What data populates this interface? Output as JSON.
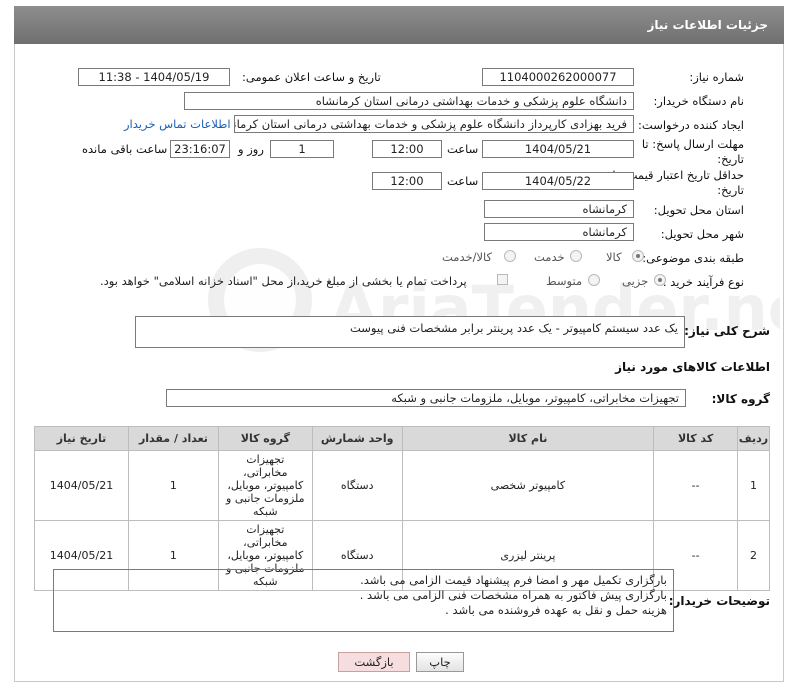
{
  "header": {
    "title": "جزئیات اطلاعات نیاز"
  },
  "fields": {
    "need_number_label": "شماره نیاز:",
    "need_number": "1104000262000077",
    "announce_label": "تاریخ و ساعت اعلان عمومی:",
    "announce_value": "1404/05/19 - 11:38",
    "buyer_org_label": "نام دستگاه خریدار:",
    "buyer_org": "دانشگاه علوم پزشکی و خدمات بهداشتی  درمانی استان کرمانشاه",
    "requester_label": "ایجاد کننده درخواست:",
    "requester": "فرید  بهزادی کارپرداز دانشگاه علوم پزشکی و خدمات بهداشتی  درمانی استان کرمانشاه",
    "contact_link": "اطلاعات تماس خریدار",
    "deadline_label": "مهلت ارسال پاسخ: تا تاریخ:",
    "deadline_date": "1404/05/21",
    "time_label": "ساعت",
    "deadline_time": "12:00",
    "days_value": "1",
    "days_label": "روز و",
    "remaining_time": "23:16:07",
    "remaining_label": "ساعت باقی مانده",
    "validity_label": "حداقل تاریخ اعتبار قیمت: تا تاریخ:",
    "validity_date": "1404/05/22",
    "validity_time": "12:00",
    "province_label": "استان محل تحویل:",
    "province": "کرمانشاه",
    "city_label": "شهر محل تحویل:",
    "city": "کرمانشاه",
    "category_label": "طبقه بندی موضوعی:",
    "category_options": [
      "کالا",
      "خدمت",
      "کالا/خدمت"
    ],
    "process_label": "نوع فرآیند خرید :",
    "process_options": [
      "جزیی",
      "متوسط"
    ],
    "payment_note": "پرداخت تمام یا بخشی از مبلغ خرید،از محل \"اسناد خزانه اسلامی\" خواهد بود.",
    "summary_label": "شرح کلی نیاز:",
    "summary": "یک عدد سیستم کامپیوتر - یک عدد پرینتر برابر مشخصات فنی پیوست",
    "goods_info_title": "اطلاعات کالاهای مورد نیاز",
    "goods_group_label": "گروه کالا:",
    "goods_group": "تجهیزات مخابراتی، کامپیوتر، موبایل، ملزومات جانبی و شبکه"
  },
  "table": {
    "headers": [
      "ردیف",
      "کد کالا",
      "نام کالا",
      "واحد شمارش",
      "گروه کالا",
      "تعداد / مقدار",
      "تاریخ نیاز"
    ],
    "rows": [
      {
        "row": "1",
        "code": "--",
        "name": "کامپیوتر شخصی",
        "unit": "دستگاه",
        "group": "تجهیزات مخابراتی، کامپیوتر، موبایل، ملزومات جانبی و شبکه",
        "qty": "1",
        "date": "1404/05/21"
      },
      {
        "row": "2",
        "code": "--",
        "name": "پرینتر لیزری",
        "unit": "دستگاه",
        "group": "تجهیزات مخابراتی، کامپیوتر، موبایل، ملزومات جانبی و شبکه",
        "qty": "1",
        "date": "1404/05/21"
      }
    ]
  },
  "buyer_notes": {
    "label": "توضیحات خریدار:",
    "lines": [
      "بارگزاری تکمیل مهر و امضا فرم پیشنهاد قیمت الزامی می باشد.",
      "بارگزاری پیش فاکتور به همراه مشخصات فنی الزامی می باشد .",
      "هزینه حمل و نقل به عهده فروشنده می باشد ."
    ]
  },
  "buttons": {
    "print": "چاپ",
    "back": "بازگشت"
  },
  "watermark": {
    "text": "AriaTender.net"
  },
  "colors": {
    "header_bg": "#7a7a7a",
    "link": "#1a5fb4",
    "back_button": "#f7dede"
  }
}
